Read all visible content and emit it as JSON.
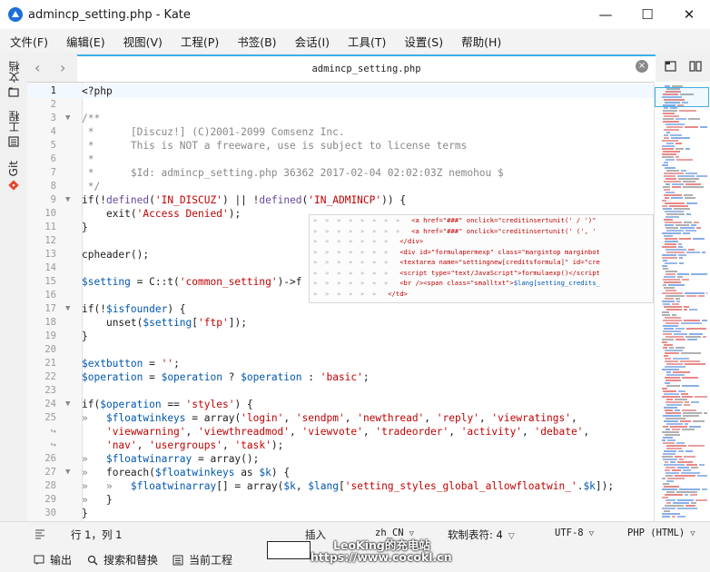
{
  "window": {
    "title": "admincp_setting.php - Kate",
    "controls": {
      "minimize": "—",
      "maximize": "☐",
      "close": "✕"
    }
  },
  "menubar": {
    "items": [
      "文件(F)",
      "编辑(E)",
      "视图(V)",
      "工程(P)",
      "书签(B)",
      "会话(I)",
      "工具(T)",
      "设置(S)",
      "帮助(H)"
    ]
  },
  "sidebar": {
    "tabs": [
      {
        "label": "文档",
        "icon": "folder-icon"
      },
      {
        "label": "工程",
        "icon": "project-icon"
      },
      {
        "label": "Git",
        "icon": "git-icon"
      }
    ]
  },
  "tabbar": {
    "back": "‹",
    "forward": "›",
    "active_tab": "admincp_setting.php",
    "close": "×"
  },
  "code_lines": [
    {
      "n": "1",
      "fold": "",
      "html": "<span class='k'>&lt;?php</span>"
    },
    {
      "n": "2",
      "fold": "",
      "html": ""
    },
    {
      "n": "3",
      "fold": "▼",
      "html": "<span class='c'>/**</span>"
    },
    {
      "n": "4",
      "fold": "",
      "html": "<span class='c'> *      [Discuz!] (C)2001-2099 Comsenz Inc.</span>"
    },
    {
      "n": "5",
      "fold": "",
      "html": "<span class='c'> *      This is NOT a freeware, use is subject to license terms</span>"
    },
    {
      "n": "6",
      "fold": "",
      "html": "<span class='c'> *</span>"
    },
    {
      "n": "7",
      "fold": "",
      "html": "<span class='c'> *      $Id: admincp_setting.php 36362 2017-02-04 02:02:03Z nemohou $</span>"
    },
    {
      "n": "8",
      "fold": "",
      "html": "<span class='c'> */</span>"
    },
    {
      "n": "9",
      "fold": "▼",
      "html": "<span class='k'>if</span>(!<span class='f'>defined</span>(<span class='s'>'IN_DISCUZ'</span>) || !<span class='f'>defined</span>(<span class='s'>'IN_ADMINCP'</span>)) {"
    },
    {
      "n": "10",
      "fold": "",
      "html": "    <span class='k'>exit</span>(<span class='s'>'Access Denied'</span>);"
    },
    {
      "n": "11",
      "fold": "",
      "html": "}"
    },
    {
      "n": "12",
      "fold": "",
      "html": ""
    },
    {
      "n": "13",
      "fold": "",
      "html": "cpheader();"
    },
    {
      "n": "14",
      "fold": "",
      "html": ""
    },
    {
      "n": "15",
      "fold": "",
      "html": "<span class='v'>$setting</span> = C::t(<span class='s'>'common_setting'</span>)-&gt;f"
    },
    {
      "n": "16",
      "fold": "",
      "html": ""
    },
    {
      "n": "17",
      "fold": "▼",
      "html": "<span class='k'>if</span>(!<span class='v'>$isfounder</span>) {"
    },
    {
      "n": "18",
      "fold": "",
      "html": "    <span class='k'>unset</span>(<span class='v'>$setting</span>[<span class='s'>'ftp'</span>]);"
    },
    {
      "n": "19",
      "fold": "",
      "html": "}"
    },
    {
      "n": "20",
      "fold": "",
      "html": ""
    },
    {
      "n": "21",
      "fold": "",
      "html": "<span class='v'>$extbutton</span> = <span class='s'>''</span>;"
    },
    {
      "n": "22",
      "fold": "",
      "html": "<span class='v'>$operation</span> = <span class='v'>$operation</span> ? <span class='v'>$operation</span> : <span class='s'>'basic'</span>;"
    },
    {
      "n": "23",
      "fold": "",
      "html": ""
    },
    {
      "n": "24",
      "fold": "▼",
      "html": "<span class='k'>if</span>(<span class='v'>$operation</span> == <span class='s'>'styles'</span>) {"
    },
    {
      "n": "25",
      "fold": "",
      "html": "<span class='c'>»</span>   <span class='v'>$floatwinkeys</span> = <span class='k'>array</span>(<span class='s'>'login'</span>, <span class='s'>'sendpm'</span>, <span class='s'>'newthread'</span>, <span class='s'>'reply'</span>, <span class='s'>'viewratings'</span>,"
    },
    {
      "n": "↪",
      "fold": "",
      "html": "    <span class='s'>'viewwarning'</span>, <span class='s'>'viewthreadmod'</span>, <span class='s'>'viewvote'</span>, <span class='s'>'tradeorder'</span>, <span class='s'>'activity'</span>, <span class='s'>'debate'</span>,"
    },
    {
      "n": "↪",
      "fold": "",
      "html": "    <span class='s'>'nav'</span>, <span class='s'>'usergroups'</span>, <span class='s'>'task'</span>);"
    },
    {
      "n": "26",
      "fold": "",
      "html": "<span class='c'>»</span>   <span class='v'>$floatwinarray</span> = <span class='k'>array</span>();"
    },
    {
      "n": "27",
      "fold": "▼",
      "html": "<span class='c'>»</span>   <span class='k'>foreach</span>(<span class='v'>$floatwinkeys</span> <span class='k'>as</span> <span class='v'>$k</span>) {"
    },
    {
      "n": "28",
      "fold": "",
      "html": "<span class='c'>»   »</span>   <span class='v'>$floatwinarray</span>[] = <span class='k'>array</span>(<span class='v'>$k</span>, <span class='v'>$lang</span>[<span class='s'>'setting_styles_global_allowfloatwin_'</span>.<span class='v'>$k</span>]);"
    },
    {
      "n": "29",
      "fold": "",
      "html": "<span class='c'>»</span>   }"
    },
    {
      "n": "30",
      "fold": "",
      "html": "}"
    }
  ],
  "tooltip_lines": [
    "<span class='d'>»  »  »  »  »  »  »  »</span>   &lt;a href=\"###\" onclick=\"creditinsertunit(' / ')\"",
    "<span class='d'>»  »  »  »  »  »  »  »</span>   &lt;a href=\"###\" onclick=\"creditinsertunit(' (', '",
    "<span class='d'>»  »  »  »  »  »  »</span>   &lt;/div&gt;",
    "<span class='d'>»  »  »  »  »  »  »</span>   &lt;div id=\"formulapermexp\" class=\"margintop marginbot",
    "<span class='d'>»  »  »  »  »  »  »</span>   &lt;textarea name=\"settingnew[creditsformula]\" id=\"cre",
    "<span class='d'>»  »  »  »  »  »  »</span>   &lt;script type=\"text/JavaScript\"&gt;formulaexp()&lt;/script",
    "<span class='d'>»  »  »  »  »  »  »</span>   &lt;br /&gt;&lt;span class=\"smalltxt\"&gt;<span class='t'>$lang[setting_credits_</span>",
    "<span class='d'>»  »  »  »  »  »</span>   &lt;/td&gt;"
  ],
  "statusbar": {
    "position": "行 1，列 1",
    "mode": "插入",
    "language": "zh_CN",
    "indent": "软制表符: 4",
    "encoding": "UTF-8",
    "syntax": "PHP (HTML)"
  },
  "bottombar": {
    "output": "输出",
    "search": "搜索和替换",
    "project": "当前工程"
  },
  "watermark": {
    "line1": "LeoKing的充电站",
    "line2": "https://www.cocokl.cn"
  },
  "colors": {
    "accent": "#3daee9",
    "string": "#bf0303",
    "variable": "#0057ae",
    "comment": "#898887"
  }
}
